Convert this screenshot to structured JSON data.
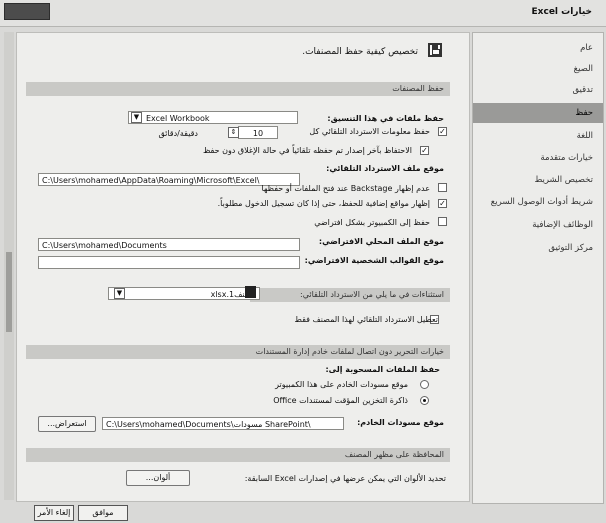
{
  "window": {
    "title": "خيارات Excel"
  },
  "sidebar": {
    "items": [
      {
        "label": "عام"
      },
      {
        "label": "الصيغ"
      },
      {
        "label": "تدقيق"
      },
      {
        "label": "حفظ"
      },
      {
        "label": "اللغة"
      },
      {
        "label": "خيارات متقدمة"
      },
      {
        "label": "تخصيص الشريط"
      },
      {
        "label": "شريط أدوات الوصول السريع"
      },
      {
        "label": "الوظائف الإضافية"
      },
      {
        "label": "مركز التوثيق"
      }
    ]
  },
  "main": {
    "intro": "تخصيص كيفية حفظ المصنفات.",
    "sections": {
      "save_workbooks": "حفظ المصنفات",
      "autorecover_exceptions": "استثناءات في ما يلي من الاسترداد التلقائي:",
      "offline_editing": "خيارات التحرير دون اتصال لملفات خادم إدارة المستندات",
      "visual_appearance": "المحافظة على مظهر المصنف"
    },
    "save_format": {
      "label": "حفظ ملفات في هذا التنسيق:",
      "value": "Excel Workbook"
    },
    "autorecover": {
      "label": "حفظ معلومات الاسترداد التلقائي كل",
      "minutes": "10",
      "unit": "دقيقة/دقائق"
    },
    "keep_last": {
      "label": "الاحتفاظ بآخر إصدار تم حفظه تلقائياً في حالة الإغلاق دون حفظ"
    },
    "autorecover_location": {
      "label": "موقع ملف الاسترداد التلقائي:",
      "value": "C:\\Users\\mohamed\\AppData\\Roaming\\Microsoft\\Excel\\"
    },
    "no_backstage": {
      "label": "عدم إظهار Backstage عند فتح الملفات أو حفظها"
    },
    "show_locations": {
      "label": "إظهار مواقع إضافية للحفظ، حتى إذا كان تسجيل الدخول مطلوباً."
    },
    "save_to_computer": {
      "label": "حفظ إلى الكمبيوتر بشكل افتراضي"
    },
    "default_local": {
      "label": "موقع الملف المحلي الافتراضي:",
      "value": "C:\\Users\\mohamed\\Documents"
    },
    "personal_templates": {
      "label": "موقع القوالب الشخصية الافتراضي:",
      "value": ""
    },
    "exceptions_workbook": {
      "value": "مصنف1.xlsx"
    },
    "disable_autorecover": {
      "label": "تعطيل الاسترداد التلقائي لهذا المصنف فقط"
    },
    "checked_out": {
      "label": "حفظ الملفات المسحوبة إلى:"
    },
    "server_drafts": {
      "label": "موقع مسودات الخادم على هذا الكمبيوتر"
    },
    "office_cache": {
      "label": "ذاكرة التخزين المؤقت لمستندات Office"
    },
    "server_location": {
      "label": "موقع مسودات الخادم:",
      "value": "C:\\Users\\mohamed\\Documents\\مسودات SharePoint\\"
    },
    "browse_label": "استعراض...",
    "colors": {
      "label": "تحديد الألوان التي يمكن عرضها في إصدارات Excel السابقة:",
      "button": "ألوان..."
    }
  },
  "footer": {
    "ok": "موافق",
    "cancel": "إلغاء الأمر"
  }
}
